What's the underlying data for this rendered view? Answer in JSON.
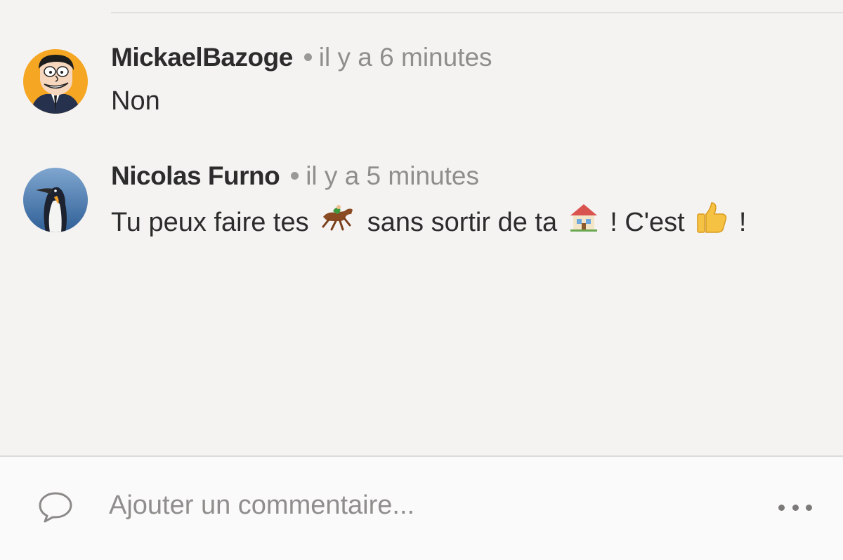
{
  "comments": [
    {
      "author": "MickaelBazoge",
      "time": "il y a 6 minutes",
      "avatar": "cartoon-man-avatar",
      "parts": [
        "Non"
      ]
    },
    {
      "author": "Nicolas Furno",
      "time": "il y a 5 minutes",
      "avatar": "penguin-avatar",
      "parts": [
        "Tu peux faire tes",
        "sans sortir de ta",
        "! C'est",
        "!"
      ],
      "emojis": [
        "horse-racing-emoji",
        "house-emoji",
        "thumbs-up-emoji"
      ]
    }
  ],
  "composer": {
    "placeholder": "Ajouter un commentaire...",
    "icon": "speech-bubble-icon",
    "more_icon": "more-dots-icon"
  },
  "colors": {
    "background": "#f4f3f2",
    "composer_background": "#fafafa",
    "text": "#2c2c2c",
    "muted": "#908e8c",
    "avatar_orange": "#f5a623",
    "avatar_blue": "#3f6fa8"
  }
}
